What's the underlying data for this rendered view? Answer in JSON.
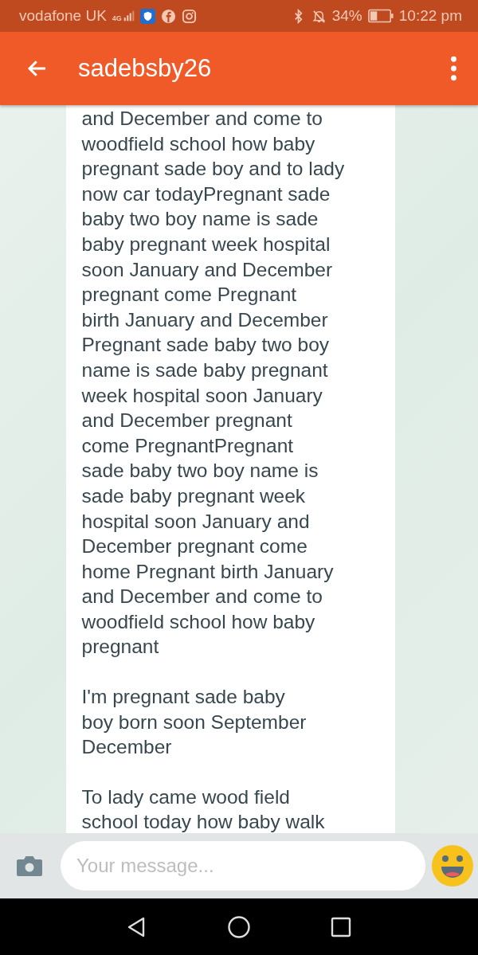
{
  "status_bar": {
    "carrier": "vodafone UK",
    "network": "4G",
    "battery": "34%",
    "time": "10:22 pm"
  },
  "header": {
    "title": "sadebsby26"
  },
  "message": {
    "paragraphs": [
      "and December and come to\nwoodfield school how baby\npregnant sade boy and to lady\nnow car todayPregnant sade\nbaby two boy name is sade\nbaby pregnant week hospital\nsoon January and December\npregnant come Pregnant\nbirth January and December\nPregnant sade baby two boy\nname is sade baby pregnant\nweek hospital soon January\nand December pregnant\ncome PregnantPregnant\nsade baby two boy name is\nsade baby pregnant week\nhospital soon January and\nDecember pregnant come\nhome Pregnant birth January\nand December and come to\nwoodfield school how baby\npregnant",
      "I'm pregnant sade baby\nboy born soon September\nDecember",
      "To lady came wood field\nschool today how baby walk"
    ]
  },
  "composer": {
    "placeholder": "Your message..."
  }
}
